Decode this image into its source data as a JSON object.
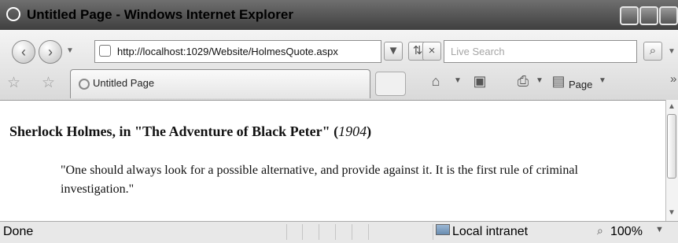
{
  "window": {
    "title": "Untitled Page - Windows Internet Explorer",
    "icons": [
      "ie-logo-icon",
      "minimize-icon",
      "maximize-icon",
      "close-icon"
    ]
  },
  "navigation": {
    "address": "http://localhost:1029/Website/HolmesQuote.aspx",
    "search_placeholder": "Live Search"
  },
  "tabs": [
    {
      "label": "Untitled Page"
    }
  ],
  "toolbar": {
    "page_label": "Page",
    "icons": [
      "favorites-star-icon",
      "add-favorites-icon",
      "home-icon",
      "feeds-icon",
      "print-icon",
      "page-icon",
      "more-tools-icon"
    ]
  },
  "page": {
    "heading_main": "Sherlock Holmes, in \"The Adventure of Black Peter\" (",
    "heading_year": "1904",
    "heading_end": ")",
    "quote": "\"One should always look for a possible alternative, and provide against it. It is the first rule of criminal investigation.\""
  },
  "status": {
    "text": "Done",
    "zone": "Local intranet",
    "zoom": "100%"
  }
}
